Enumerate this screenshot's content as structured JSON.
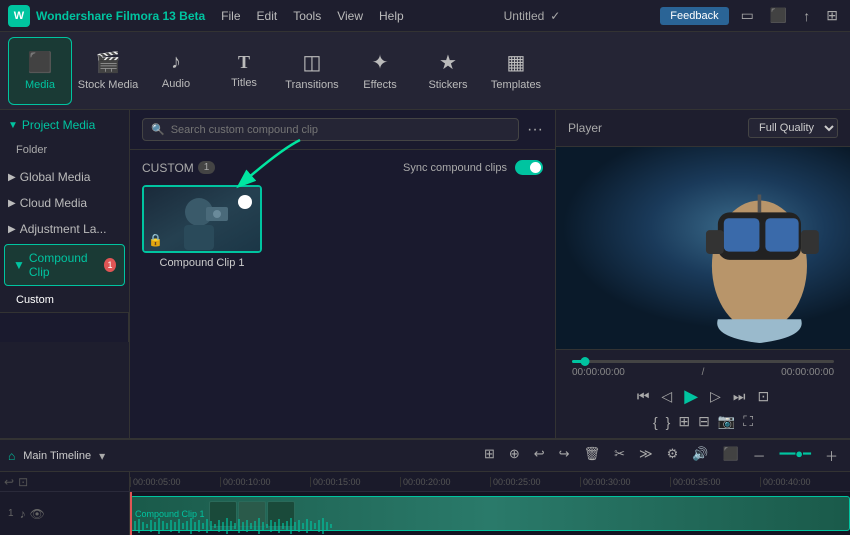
{
  "app": {
    "name": "Wondershare Filmora 13 Beta",
    "title": "Untitled",
    "feedback_btn": "Feedback"
  },
  "menu": {
    "items": [
      "File",
      "Edit",
      "Tools",
      "View",
      "Help"
    ]
  },
  "toolbar": {
    "items": [
      {
        "id": "media",
        "label": "Media",
        "icon": "⬛",
        "active": true
      },
      {
        "id": "stock",
        "label": "Stock Media",
        "icon": "🎬"
      },
      {
        "id": "audio",
        "label": "Audio",
        "icon": "♪"
      },
      {
        "id": "titles",
        "label": "Titles",
        "icon": "T"
      },
      {
        "id": "transitions",
        "label": "Transitions",
        "icon": "◫"
      },
      {
        "id": "effects",
        "label": "Effects",
        "icon": "✦"
      },
      {
        "id": "stickers",
        "label": "Stickers",
        "icon": "★"
      },
      {
        "id": "templates",
        "label": "Templates",
        "icon": "▦"
      }
    ]
  },
  "sidebar": {
    "sections": [
      {
        "id": "project-media",
        "label": "Project Media",
        "expanded": true,
        "arrow": "▼"
      },
      {
        "id": "folder",
        "label": "Folder",
        "indent": true
      },
      {
        "id": "global-media",
        "label": "Global Media",
        "arrow": "▶"
      },
      {
        "id": "cloud-media",
        "label": "Cloud Media",
        "arrow": "▶"
      },
      {
        "id": "adjustment",
        "label": "Adjustment La...",
        "arrow": "▶"
      },
      {
        "id": "compound-clip",
        "label": "Compound Clip",
        "badge": "1",
        "active": true
      },
      {
        "id": "custom",
        "label": "Custom",
        "indent": true
      }
    ]
  },
  "content": {
    "search_placeholder": "Search custom compound clip",
    "custom_label": "CUSTOM",
    "custom_count": "1",
    "sync_label": "Sync compound clips",
    "clips": [
      {
        "id": "clip1",
        "label": "Compound Clip 1"
      }
    ]
  },
  "player": {
    "label": "Player",
    "quality": "Full Quality",
    "time_current": "00:00:00:00",
    "time_total": "00:00:00:00",
    "time_separator": "/"
  },
  "timeline": {
    "label": "Main Timeline",
    "ruler_marks": [
      "00:00:05:00",
      "00:00:10:00",
      "00:00:15:00",
      "00:00:20:00",
      "00:00:25:00",
      "00:00:30:00",
      "00:00:35:00",
      "00:00:40:00"
    ],
    "track": {
      "num": "1",
      "clip_label": "Compound Clip 1"
    }
  }
}
